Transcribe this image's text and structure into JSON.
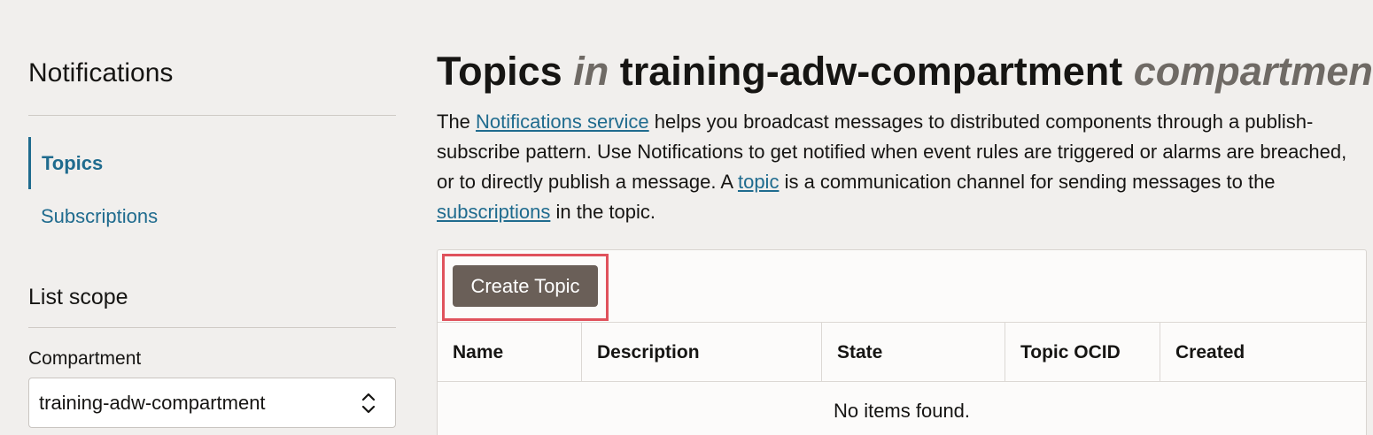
{
  "sidebar": {
    "title": "Notifications",
    "nav": [
      {
        "label": "Topics",
        "active": true
      },
      {
        "label": "Subscriptions",
        "active": false
      }
    ],
    "list_scope_title": "List scope",
    "compartment_label": "Compartment",
    "compartment_value": "training-adw-compartment",
    "compartment_icon": "chevron-up-down-icon"
  },
  "main": {
    "title_part1": "Topics",
    "title_in": "in",
    "title_compartment_name": "training-adw-compartment",
    "title_suffix": "compartment",
    "intro": {
      "t1": "The ",
      "link1": "Notifications service",
      "t2": " helps you broadcast messages to distributed components through a publish-subscribe pattern. Use Notifications to get notified when event rules are triggered or alarms are breached, or to directly publish a message. A ",
      "link2": "topic",
      "t3": " is a communication channel for sending messages to the ",
      "link3": "subscriptions",
      "t4": " in the topic."
    },
    "create_button": "Create Topic",
    "columns": [
      "Name",
      "Description",
      "State",
      "Topic OCID",
      "Created"
    ],
    "empty_message": "No items found."
  },
  "colors": {
    "link": "#1f6b8e",
    "button_bg": "#6a5f58",
    "highlight": "#e0525c",
    "background": "#f1efed"
  }
}
